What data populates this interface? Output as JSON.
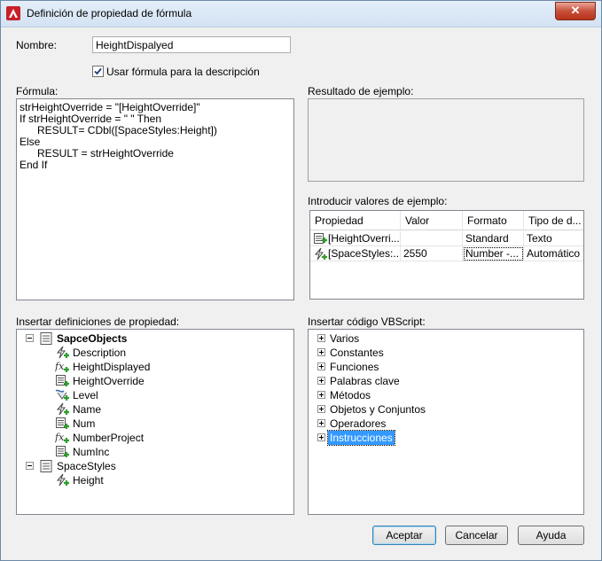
{
  "window": {
    "title": "Definición de propiedad de fórmula",
    "close_glyph": "✕"
  },
  "name_field": {
    "label": "Nombre:",
    "value": "HeightDispalyed"
  },
  "use_formula_checkbox": {
    "label": "Usar fórmula para la descripción",
    "checked": true
  },
  "formula": {
    "label": "Fórmula:",
    "lines": [
      "strHeightOverride = \"[HeightOverride]\"",
      "If strHeightOverride = \" \" Then",
      "      RESULT= CDbl([SpaceStyles:Height])",
      "Else",
      "      RESULT = strHeightOverride",
      "End If"
    ]
  },
  "sample_result": {
    "label": "Resultado de ejemplo:",
    "value": ""
  },
  "sample_values": {
    "label": "Introducir valores de ejemplo:",
    "columns": [
      "Propiedad",
      "Valor",
      "Formato",
      "Tipo de d..."
    ],
    "rows": [
      {
        "icon": "property-table-icon",
        "property": "[HeightOverri...",
        "value": "",
        "format": "Standard",
        "type": "Texto"
      },
      {
        "icon": "automatic-property-icon",
        "property": "[SpaceStyles:...",
        "value": "2550",
        "format": "Number -...",
        "type": "Automático"
      }
    ]
  },
  "property_definitions": {
    "label": "Insertar definiciones de propiedad:",
    "groups": [
      {
        "name": "SapceObjects",
        "items": [
          {
            "icon": "automatic-property-icon",
            "label": "Description"
          },
          {
            "icon": "formula-property-icon",
            "label": "HeightDisplayed"
          },
          {
            "icon": "property-table-icon",
            "label": "HeightOverride"
          },
          {
            "icon": "location-property-icon",
            "label": "Level"
          },
          {
            "icon": "automatic-property-icon",
            "label": "Name"
          },
          {
            "icon": "property-table-icon",
            "label": "Num"
          },
          {
            "icon": "formula-property-icon",
            "label": "NumberProject"
          },
          {
            "icon": "property-table-icon",
            "label": "NumInc"
          }
        ]
      },
      {
        "name": "SpaceStyles",
        "items": [
          {
            "icon": "automatic-property-icon",
            "label": "Height"
          }
        ]
      }
    ]
  },
  "vbscript": {
    "label": "Insertar código VBScript:",
    "items": [
      "Varios",
      "Constantes",
      "Funciones",
      "Palabras clave",
      "Métodos",
      "Objetos y Conjuntos",
      "Operadores",
      "Instrucciones"
    ],
    "selected": "Instrucciones"
  },
  "buttons": {
    "accept": "Aceptar",
    "cancel": "Cancelar",
    "help": "Ayuda"
  },
  "colors": {
    "selection": "#3399ff",
    "icon_green": "#2e9e2e",
    "title_bar": "#dbe7f5"
  }
}
